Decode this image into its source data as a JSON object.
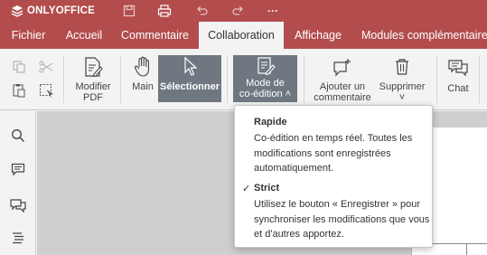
{
  "app": {
    "brand": "ONLYOFFICE",
    "more_label": "···"
  },
  "colors": {
    "brand": "#b34c4c",
    "active_button": "#6f7780"
  },
  "tabs": [
    {
      "label": "Fichier"
    },
    {
      "label": "Accueil"
    },
    {
      "label": "Commentaire"
    },
    {
      "label": "Collaboration",
      "active": true
    },
    {
      "label": "Affichage"
    },
    {
      "label": "Modules complémentaires"
    }
  ],
  "ribbon": {
    "edit_pdf": "Modifier\nPDF",
    "hand": "Main",
    "select": "Sélectionner",
    "coedit": "Mode de\nco-édition ˄",
    "add_comment": "Ajouter un\ncommentaire",
    "delete": "Supprimer\n˅",
    "chat": "Chat"
  },
  "coedit_menu": {
    "fast": {
      "title": "Rapide",
      "description": "Co-édition en temps réel. Toutes les modifications sont enregistrées automatiquement.",
      "checked": false
    },
    "strict": {
      "title": "Strict",
      "description": "Utilisez le bouton « Enregistrer » pour synchroniser les modifications que vous et d'autres apportez.",
      "checked": true,
      "check_mark": "✓"
    }
  }
}
